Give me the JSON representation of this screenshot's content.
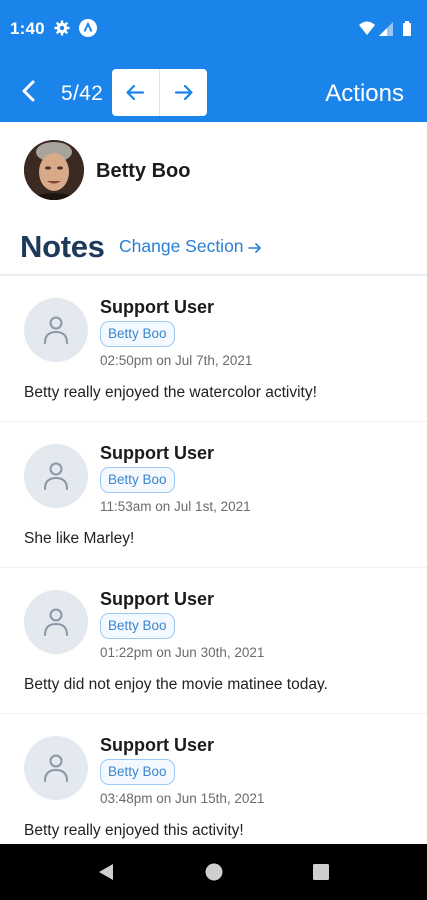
{
  "status_bar": {
    "time": "1:40",
    "icons": [
      "gear-icon",
      "a-badge-icon",
      "wifi-icon",
      "signal-icon",
      "battery-icon"
    ]
  },
  "app_bar": {
    "counter": "5/42",
    "actions_label": "Actions",
    "color": "#1a84ea",
    "icons": [
      "back-chevron-icon",
      "arrow-left-icon",
      "arrow-right-icon"
    ]
  },
  "profile": {
    "name": "Betty Boo"
  },
  "section": {
    "title": "Notes",
    "change_label": "Change Section",
    "title_color": "#1d3a5a",
    "link_color": "#2a7fd3"
  },
  "notes": [
    {
      "author": "Support User",
      "tag": "Betty Boo",
      "time": "02:50pm on Jul 7th, 2021",
      "body": "Betty really enjoyed the watercolor activity!"
    },
    {
      "author": "Support User",
      "tag": "Betty Boo",
      "time": "11:53am on Jul 1st, 2021",
      "body": "She like Marley!"
    },
    {
      "author": "Support User",
      "tag": "Betty Boo",
      "time": "01:22pm on Jun 30th, 2021",
      "body": "Betty did not enjoy the movie matinee today."
    },
    {
      "author": "Support User",
      "tag": "Betty Boo",
      "time": "03:48pm on Jun 15th, 2021",
      "body": "Betty really enjoyed this activity!"
    }
  ],
  "system_nav": {
    "icons": [
      "back-triangle-icon",
      "home-circle-icon",
      "recents-square-icon"
    ]
  }
}
